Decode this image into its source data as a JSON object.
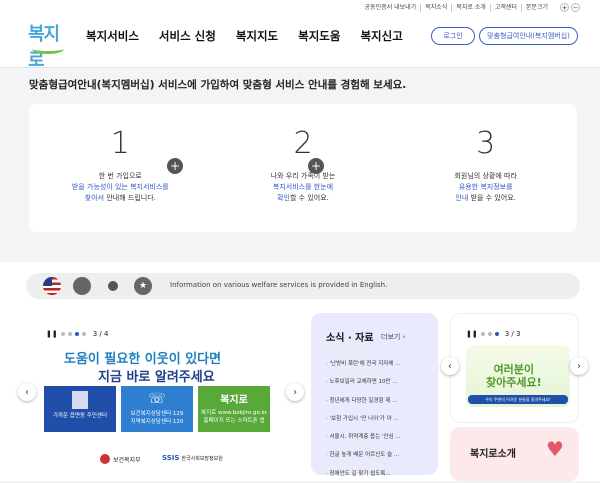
{
  "util_links": [
    "공동인증서 내보내기",
    "복지소식",
    "복지로 소개",
    "고객센터",
    "본문크기"
  ],
  "logo_text": "복지로",
  "nav": [
    "복지서비스",
    "서비스 신청",
    "복지지도",
    "복지도움",
    "복지신고"
  ],
  "login_label": "로그인",
  "guide_label": "맞춤형급여안내(복지멤버십)",
  "headline": "맞춤형급여안내(복지멤버십) 서비스에 가입하여 맞춤형 서비스 안내를 경험해 보세요.",
  "steps": [
    {
      "num": "1",
      "l1": "한 번 가입으로",
      "l2": "받을 가능성이 있는 복지서비스를",
      "l3a": "찾아서",
      "l3b": " 안내해 드립니다."
    },
    {
      "num": "2",
      "l1": "나와 우리 가족이 받는",
      "l2": "복지서비스를 한눈에",
      "l3a": "확인",
      "l3b": "할 수 있어요."
    },
    {
      "num": "3",
      "l1": "회원님의 상황에 따라",
      "l2": "유용한 복지정보를",
      "l3a": "안내",
      "l3b": " 받을 수 있어요."
    }
  ],
  "lang_text": "Information on various welfare services is provided in English.",
  "banner": {
    "page": "3 / 4",
    "title1": "도움이 필요한 이웃이 있다면",
    "title2": "지금 바로 알려주세요",
    "card1": "가까운 읍면동 주민센터",
    "card2a": "보건복지상담센터 129",
    "card2b": "지역복지상담센터 120",
    "card3a": "복지로 www.bokjiro.go.kr",
    "card3b": "홈페이지 또는 스마트폰 앱",
    "org1": "보건복지부",
    "org2": "한국사회보장정보원"
  },
  "news": {
    "title": "소식 · 자료",
    "more": "더보기 ›",
    "items": [
      "'난방비 폭탄'에 전국 지자체 ...",
      "노후보일러 교체하면 10만 ...",
      "청년에게 다양한 일경험 제 ...",
      "'보험 가입시 '만 나이'가 아 ...",
      "서울시, 취약계층 돕는 '안심 ...",
      "한글 높게 배운 어르신도 술 ...",
      "장애인도 길 찾기 쉽도록..."
    ]
  },
  "side_banner": {
    "page": "3 / 3",
    "text1": "여러분이",
    "text2": "찾아주세요!",
    "sub": "우리 주변의 어려운 분들을 알려주세요!"
  },
  "side2": "복지로소개"
}
